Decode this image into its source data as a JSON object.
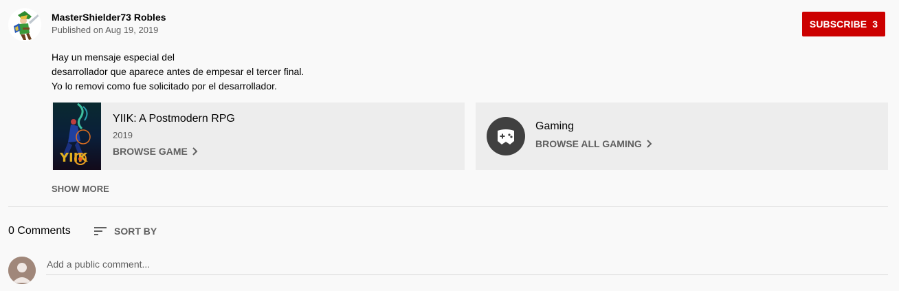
{
  "owner": {
    "channel_name": "MasterShielder73 Robles",
    "published_date": "Published on Aug 19, 2019",
    "subscribe_label": "SUBSCRIBE",
    "subscriber_count": "3"
  },
  "description": {
    "lines": [
      "Hay un mensaje especial del",
      "desarrollador que aparece antes de empesar el tercer final.",
      "Yo lo removi como fue solicitado por el desarrollador."
    ]
  },
  "game_card": {
    "title": "YIIK: A Postmodern RPG",
    "year": "2019",
    "browse_label": "BROWSE GAME",
    "boxart_icon": "game-boxart-icon"
  },
  "topic_card": {
    "title": "Gaming",
    "browse_label": "BROWSE ALL GAMING",
    "icon": "gamepad-icon"
  },
  "show_more_label": "SHOW MORE",
  "comments": {
    "count_label": "0 Comments",
    "sort_label": "SORT BY",
    "input_placeholder": "Add a public comment..."
  },
  "colors": {
    "subscribe_bg": "#cc0000",
    "card_bg": "#ededed",
    "page_bg": "#f9f9f9",
    "secondary_text": "#606060"
  }
}
